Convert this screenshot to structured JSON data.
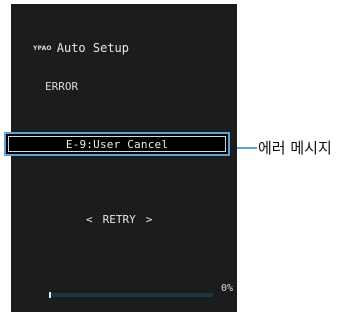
{
  "screen": {
    "brand_icon": "mcacc-logo-icon",
    "brand_text": "YPAO",
    "title": "Auto Setup",
    "status": "ERROR",
    "error_message": "E-9:User Cancel",
    "retry": {
      "left_arrow": "<",
      "label": "RETRY",
      "right_arrow": ">"
    },
    "progress": {
      "fraction": 0.0,
      "label": "0%"
    }
  },
  "callout": {
    "label": "에러 메시지"
  },
  "colors": {
    "screen_bg": "#1b1c1e",
    "highlight_border": "#5aa3d6",
    "progress_track": "#1c3742",
    "text": "#e6e6e6"
  }
}
